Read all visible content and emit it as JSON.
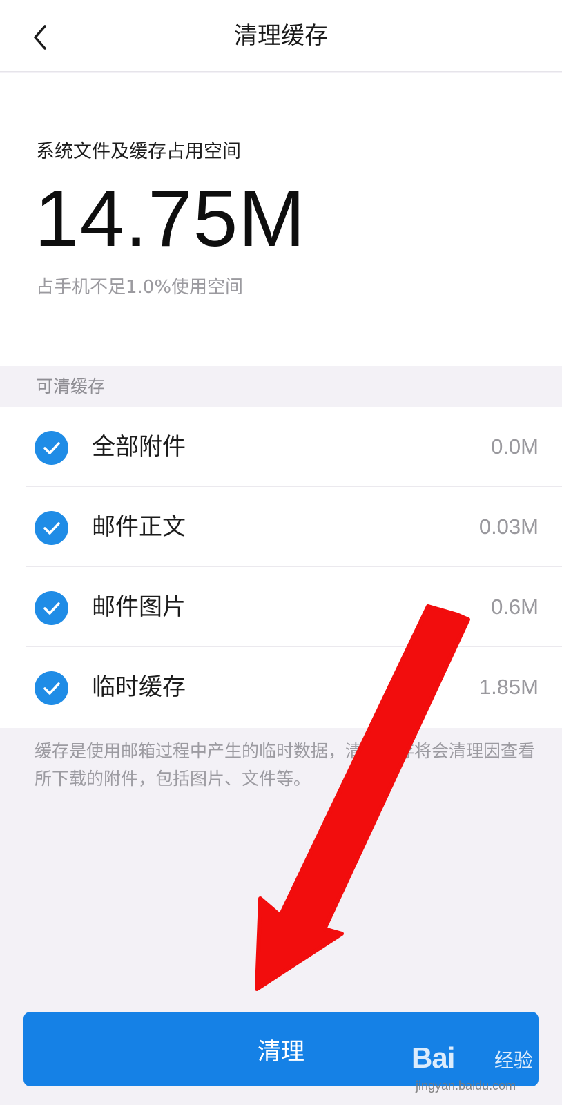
{
  "header": {
    "title": "清理缓存",
    "back_icon": "chevron-left-icon"
  },
  "summary": {
    "label": "系统文件及缓存占用空间",
    "size": "14.75M",
    "note": "占手机不足1.0%使用空间"
  },
  "cache": {
    "section_title": "可清缓存",
    "items": [
      {
        "label": "全部附件",
        "size": "0.0M",
        "checked": true
      },
      {
        "label": "邮件正文",
        "size": "0.03M",
        "checked": true
      },
      {
        "label": "邮件图片",
        "size": "0.6M",
        "checked": true
      },
      {
        "label": "临时缓存",
        "size": "1.85M",
        "checked": true
      }
    ],
    "footnote": "缓存是使用邮箱过程中产生的临时数据，清理缓存将会清理因查看所下载的附件，包括图片、文件等。"
  },
  "action": {
    "clean_label": "清理"
  },
  "watermark": {
    "brand": "Bai",
    "brand_cn": "经验",
    "url": "jingyan.baidu.com"
  },
  "colors": {
    "accent": "#1581e6",
    "check": "#1f8ce6",
    "annotation_arrow": "#f20d0d"
  }
}
